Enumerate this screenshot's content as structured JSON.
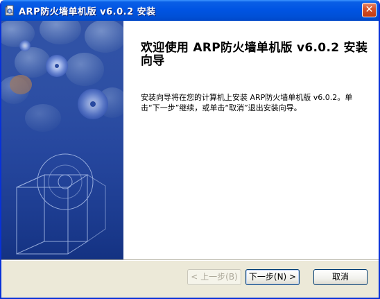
{
  "window": {
    "title": "ARP防火墙单机版 v6.0.2 安装",
    "close_icon": "close-icon",
    "app_icon": "installer-icon"
  },
  "banner": {
    "image": "cd-box-illustration"
  },
  "content": {
    "heading": "欢迎使用 ARP防火墙单机版 v6.0.2 安装向导",
    "description": "安装向导将在您的计算机上安装 ARP防火墙单机版 v6.0.2。单击“下一步”继续，或单击“取消”退出安装向导。"
  },
  "buttons": {
    "back": "< 上一步(B)",
    "next": "下一步(N) >",
    "cancel": "取消"
  },
  "colors": {
    "titlebar": "#0054e3",
    "banner": "#2e54a8",
    "dialog_bg": "#ece9d8"
  }
}
